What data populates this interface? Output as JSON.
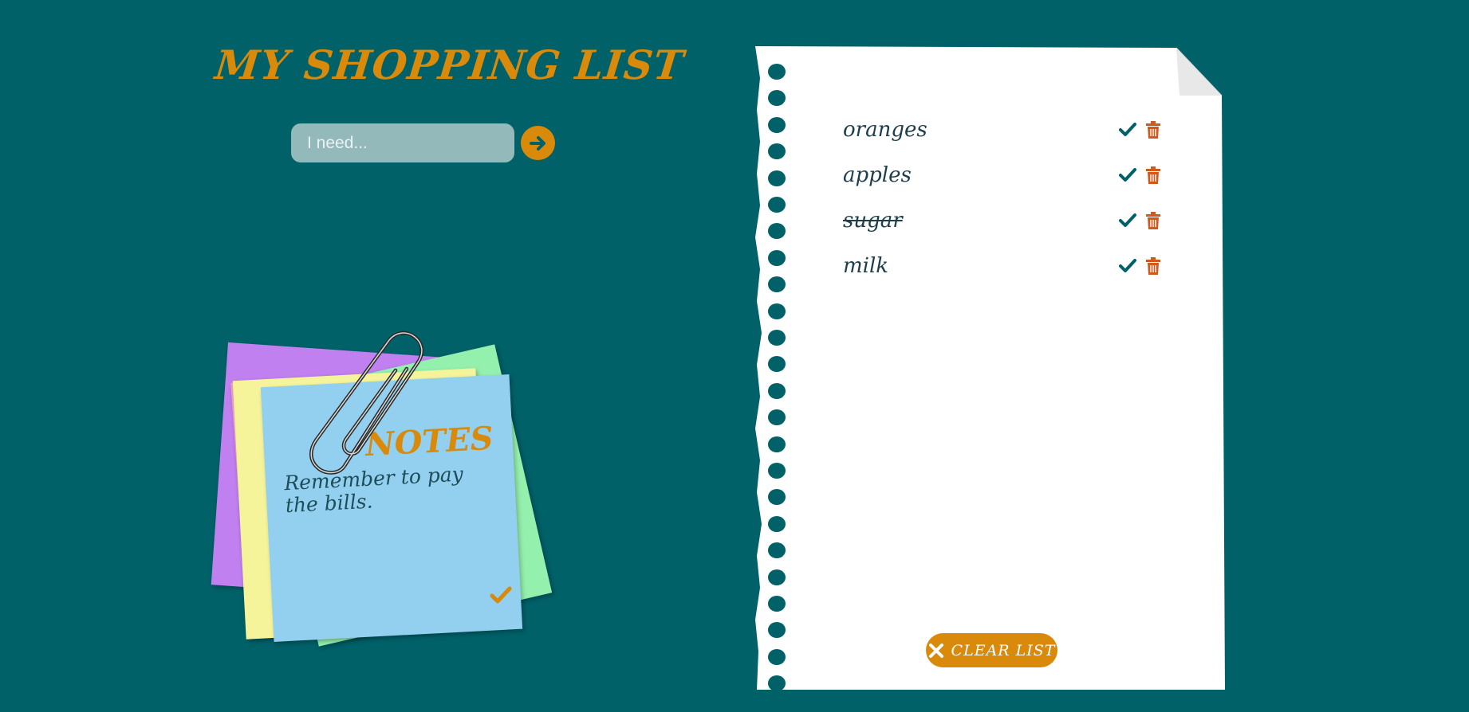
{
  "header": {
    "title": "MY SHOPPING LIST"
  },
  "input": {
    "placeholder": "I need...",
    "value": "",
    "add_icon": "arrow-right-circle-icon"
  },
  "notes": {
    "title": "NOTES",
    "body": "Remember to pay the bills.",
    "colors": [
      "#c080f0",
      "#f3a0c4",
      "#94f0ad",
      "#f5f49a",
      "#93cfee"
    ]
  },
  "list": {
    "items": [
      {
        "label": "oranges",
        "done": false
      },
      {
        "label": "apples",
        "done": false
      },
      {
        "label": "sugar",
        "done": true
      },
      {
        "label": "milk",
        "done": false
      }
    ],
    "clear_label": "CLEAR LIST"
  },
  "colors": {
    "background": "#006168",
    "accent": "#d98a0a",
    "check": "#006168",
    "trash": "#d2591a"
  }
}
